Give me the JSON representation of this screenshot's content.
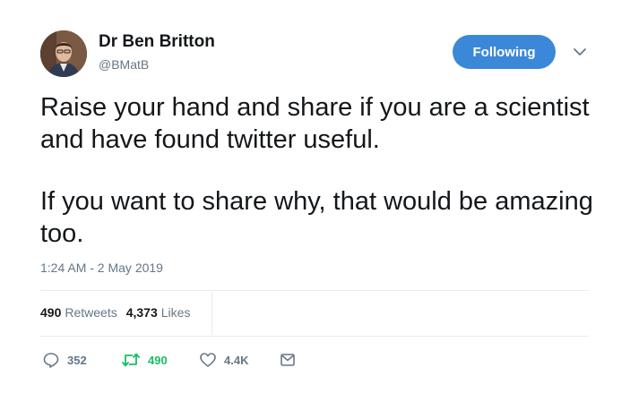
{
  "author": {
    "display_name": "Dr Ben Britton",
    "handle": "@BMatB",
    "follow_label": "Following"
  },
  "tweet": {
    "paragraphs": [
      "Raise your hand and share if you are a scientist and have found twitter useful.",
      "If you want to share why, that would be amazing too."
    ],
    "timestamp": "1:24 AM - 2 May 2019"
  },
  "stats": {
    "retweets_count": "490",
    "retweets_label": "Retweets",
    "likes_count": "4,373",
    "likes_label": "Likes"
  },
  "actions": {
    "reply_count": "352",
    "retweet_count": "490",
    "like_count": "4.4K"
  },
  "icons": {
    "reply": "reply-icon",
    "retweet": "retweet-icon",
    "like": "heart-icon",
    "message": "envelope-icon",
    "caret": "chevron-down-icon"
  },
  "colors": {
    "follow_button": "#3b88d8",
    "retweet_active": "#17bf63",
    "secondary_text": "#657786"
  }
}
